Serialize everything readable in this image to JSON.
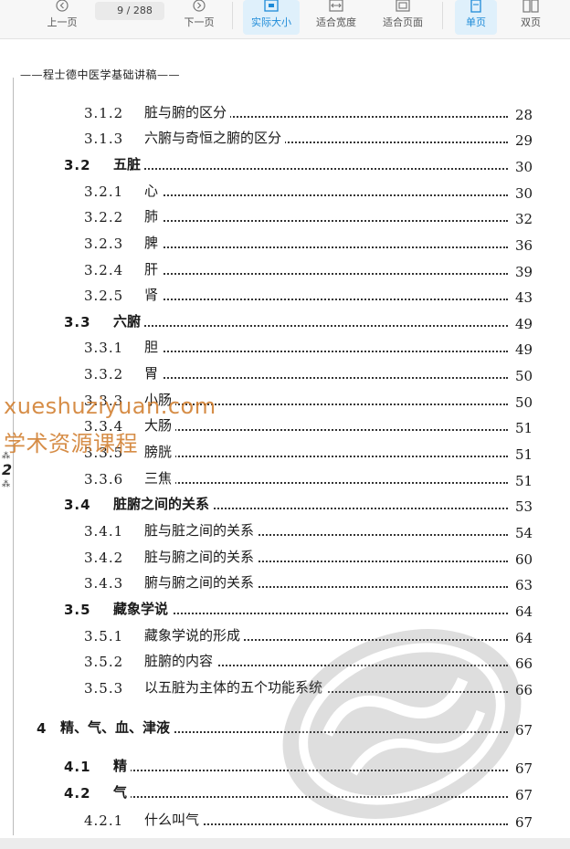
{
  "toolbar": {
    "prev_label": "上一页",
    "current_page": "9",
    "total_pages": "/ 288",
    "next_label": "下一页",
    "actual_size_label": "实际大小",
    "fit_width_label": "适合宽度",
    "fit_page_label": "适合页面",
    "single_page_label": "单页",
    "double_page_label": "双页",
    "active_color": "#1e8bd8"
  },
  "page": {
    "running_header": "——程士德中医学基础讲稿——",
    "page_number": "2",
    "ornament": "⁂",
    "toc": [
      {
        "num": "3.1.2",
        "title": "脏与腑的区分",
        "page": "28",
        "level": 3
      },
      {
        "num": "3.1.3",
        "title": "六腑与奇恒之腑的区分",
        "page": "29",
        "level": 3
      },
      {
        "num": "3.2",
        "title": "五脏",
        "page": "30",
        "level": 2
      },
      {
        "num": "3.2.1",
        "title": "心",
        "page": "30",
        "level": 3
      },
      {
        "num": "3.2.2",
        "title": "肺",
        "page": "32",
        "level": 3
      },
      {
        "num": "3.2.3",
        "title": "脾",
        "page": "36",
        "level": 3
      },
      {
        "num": "3.2.4",
        "title": "肝",
        "page": "39",
        "level": 3
      },
      {
        "num": "3.2.5",
        "title": "肾",
        "page": "43",
        "level": 3
      },
      {
        "num": "3.3",
        "title": "六腑",
        "page": "49",
        "level": 2
      },
      {
        "num": "3.3.1",
        "title": "胆",
        "page": "49",
        "level": 3
      },
      {
        "num": "3.3.2",
        "title": "胃",
        "page": "50",
        "level": 3
      },
      {
        "num": "3.3.3",
        "title": "小肠",
        "page": "50",
        "level": 3
      },
      {
        "num": "3.3.4",
        "title": "大肠",
        "page": "51",
        "level": 3
      },
      {
        "num": "3.3.5",
        "title": "膀胱",
        "page": "51",
        "level": 3
      },
      {
        "num": "3.3.6",
        "title": "三焦",
        "page": "51",
        "level": 3
      },
      {
        "num": "3.4",
        "title": "脏腑之间的关系",
        "page": "53",
        "level": 2
      },
      {
        "num": "3.4.1",
        "title": "脏与脏之间的关系",
        "page": "54",
        "level": 3
      },
      {
        "num": "3.4.2",
        "title": "脏与腑之间的关系",
        "page": "60",
        "level": 3
      },
      {
        "num": "3.4.3",
        "title": "腑与腑之间的关系",
        "page": "63",
        "level": 3
      },
      {
        "num": "3.5",
        "title": "藏象学说",
        "page": "64",
        "level": 2
      },
      {
        "num": "3.5.1",
        "title": "藏象学说的形成",
        "page": "64",
        "level": 3
      },
      {
        "num": "3.5.2",
        "title": "脏腑的内容",
        "page": "66",
        "level": 3
      },
      {
        "num": "3.5.3",
        "title": "以五脏为主体的五个功能系统",
        "page": "66",
        "level": 3
      },
      {
        "num": "4",
        "title": "精、气、血、津液",
        "page": "67",
        "level": 1
      },
      {
        "num": "4.1",
        "title": "精",
        "page": "67",
        "level": 2
      },
      {
        "num": "4.2",
        "title": "气",
        "page": "67",
        "level": 2
      },
      {
        "num": "4.2.1",
        "title": "什么叫气",
        "page": "67",
        "level": 3
      }
    ]
  },
  "watermark": {
    "line1": "xueshuziyuan.com",
    "line2": "学术资源课程",
    "color": "#d07a28"
  }
}
